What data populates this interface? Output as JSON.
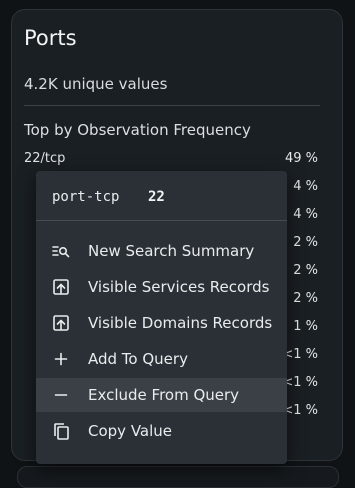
{
  "card": {
    "title": "Ports",
    "subtitle": "4.2K unique values",
    "section": "Top by Observation Frequency",
    "first_label": "22/tcp",
    "percentages": [
      "49 %",
      "4 %",
      "4 %",
      "2 %",
      "2 %",
      "2 %",
      "1 %",
      "<1 %",
      "<1 %",
      "<1 %"
    ]
  },
  "menu": {
    "key": "port-tcp",
    "value": "22",
    "items": [
      {
        "label": "New Search Summary",
        "icon": "search-summary-icon"
      },
      {
        "label": "Visible Services Records",
        "icon": "open-in-new-icon"
      },
      {
        "label": "Visible Domains Records",
        "icon": "open-in-new-icon"
      },
      {
        "label": "Add To Query",
        "icon": "plus-icon"
      },
      {
        "label": "Exclude From Query",
        "icon": "minus-icon"
      },
      {
        "label": "Copy Value",
        "icon": "copy-icon"
      }
    ]
  },
  "colors": {
    "background": "#0f1316",
    "card": "#1a1f23",
    "menu": "#2a3035",
    "hover": "#3a4045"
  }
}
